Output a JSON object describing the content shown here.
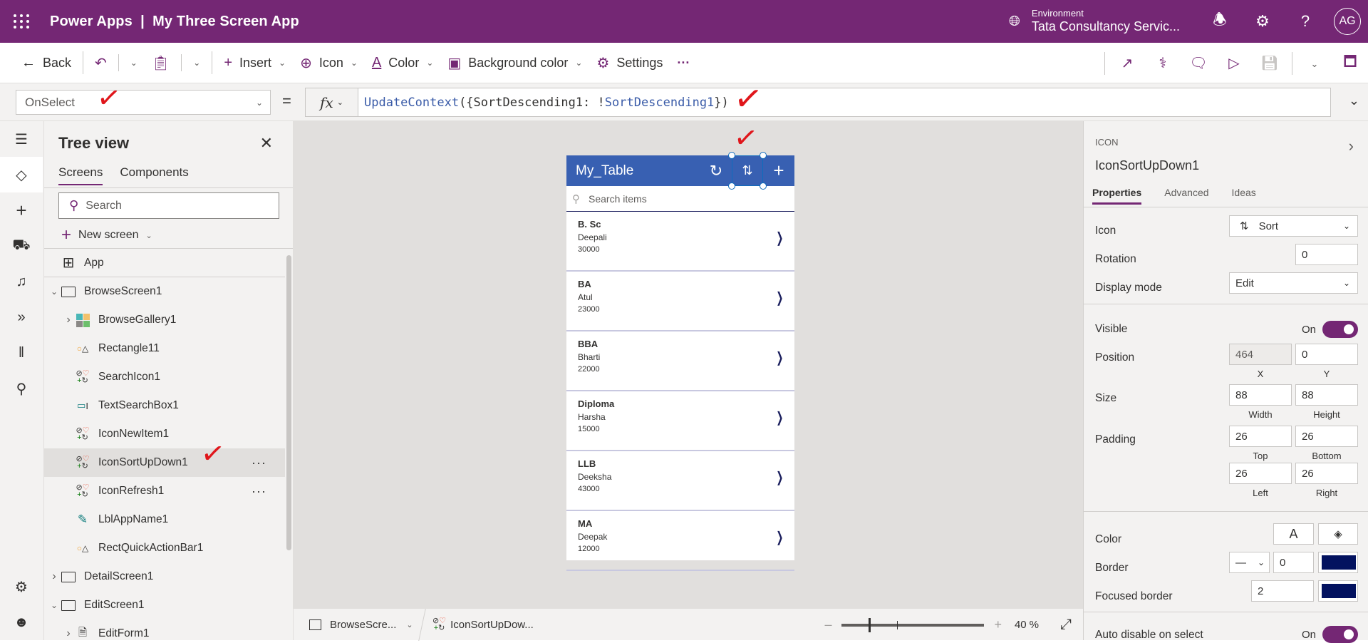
{
  "topbar": {
    "title": "Power Apps  |  My Three Screen App",
    "environment_label": "Environment",
    "environment_name": "Tata Consultancy Servic...",
    "avatar_initials": "AG"
  },
  "cmdbar": {
    "back": "Back",
    "insert": "Insert",
    "icon": "Icon",
    "color": "Color",
    "background_color": "Background color",
    "settings": "Settings",
    "more": "···"
  },
  "formula": {
    "property": "OnSelect",
    "equals": "=",
    "fx": "fx",
    "code_fn": "UpdateContext",
    "code_mid": "({SortDescending1: !",
    "code_var": "SortDescending1",
    "code_end": "})"
  },
  "tree": {
    "title": "Tree view",
    "tabs": [
      "Screens",
      "Components"
    ],
    "search_placeholder": "Search",
    "new_screen": "New screen",
    "items": [
      {
        "label": "App",
        "level": 0,
        "type": "app"
      },
      {
        "label": "BrowseScreen1",
        "level": 0,
        "type": "screen",
        "expanded": true
      },
      {
        "label": "BrowseGallery1",
        "level": 1,
        "type": "gallery",
        "expanded": false
      },
      {
        "label": "Rectangle11",
        "level": 1,
        "type": "shape"
      },
      {
        "label": "SearchIcon1",
        "level": 1,
        "type": "icon"
      },
      {
        "label": "TextSearchBox1",
        "level": 1,
        "type": "input"
      },
      {
        "label": "IconNewItem1",
        "level": 1,
        "type": "icon"
      },
      {
        "label": "IconSortUpDown1",
        "level": 1,
        "type": "icon",
        "selected": true
      },
      {
        "label": "IconRefresh1",
        "level": 1,
        "type": "icon"
      },
      {
        "label": "LblAppName1",
        "level": 1,
        "type": "label"
      },
      {
        "label": "RectQuickActionBar1",
        "level": 1,
        "type": "shape"
      },
      {
        "label": "DetailScreen1",
        "level": 0,
        "type": "screen",
        "expanded": false
      },
      {
        "label": "EditScreen1",
        "level": 0,
        "type": "screen",
        "expanded": true
      },
      {
        "label": "EditForm1",
        "level": 1,
        "type": "form",
        "expanded": false
      }
    ]
  },
  "app_preview": {
    "title": "My_Table",
    "search_placeholder": "Search items",
    "rows": [
      {
        "title": "B. Sc",
        "subtitle": "Deepali",
        "value": "30000"
      },
      {
        "title": "BA",
        "subtitle": "Atul",
        "value": "23000"
      },
      {
        "title": "BBA",
        "subtitle": "Bharti",
        "value": "22000"
      },
      {
        "title": "Diploma",
        "subtitle": "Harsha",
        "value": "15000"
      },
      {
        "title": "LLB",
        "subtitle": "Deeksha",
        "value": "43000"
      },
      {
        "title": "MA",
        "subtitle": "Deepak",
        "value": "12000"
      }
    ]
  },
  "statusbar": {
    "screen": "BrowseScre...",
    "control": "IconSortUpDow...",
    "zoom_value": "40",
    "zoom_unit": "%"
  },
  "props": {
    "type": "ICON",
    "name": "IconSortUpDown1",
    "tabs": [
      "Properties",
      "Advanced",
      "Ideas"
    ],
    "icon_label": "Icon",
    "icon_value": "Sort",
    "rotation_label": "Rotation",
    "rotation_value": "0",
    "display_mode_label": "Display mode",
    "display_mode_value": "Edit",
    "visible_label": "Visible",
    "visible_state": "On",
    "position_label": "Position",
    "position_x": "464",
    "position_y": "0",
    "x_cap": "X",
    "y_cap": "Y",
    "size_label": "Size",
    "width": "88",
    "height": "88",
    "width_cap": "Width",
    "height_cap": "Height",
    "padding_label": "Padding",
    "padding_top": "26",
    "padding_bottom": "26",
    "padding_left": "26",
    "padding_right": "26",
    "top_cap": "Top",
    "bottom_cap": "Bottom",
    "left_cap": "Left",
    "right_cap": "Right",
    "color_label": "Color",
    "color_text_glyph": "A",
    "border_label": "Border",
    "border_width": "0",
    "border_color": "#03125f",
    "focused_border_label": "Focused border",
    "focused_border_width": "2",
    "focused_border_color": "#03125f",
    "auto_disable_label": "Auto disable on select",
    "auto_disable_state": "On"
  },
  "colors": {
    "brand": "#742774",
    "app_header": "#3860b2",
    "annotation": "#e0161b"
  }
}
